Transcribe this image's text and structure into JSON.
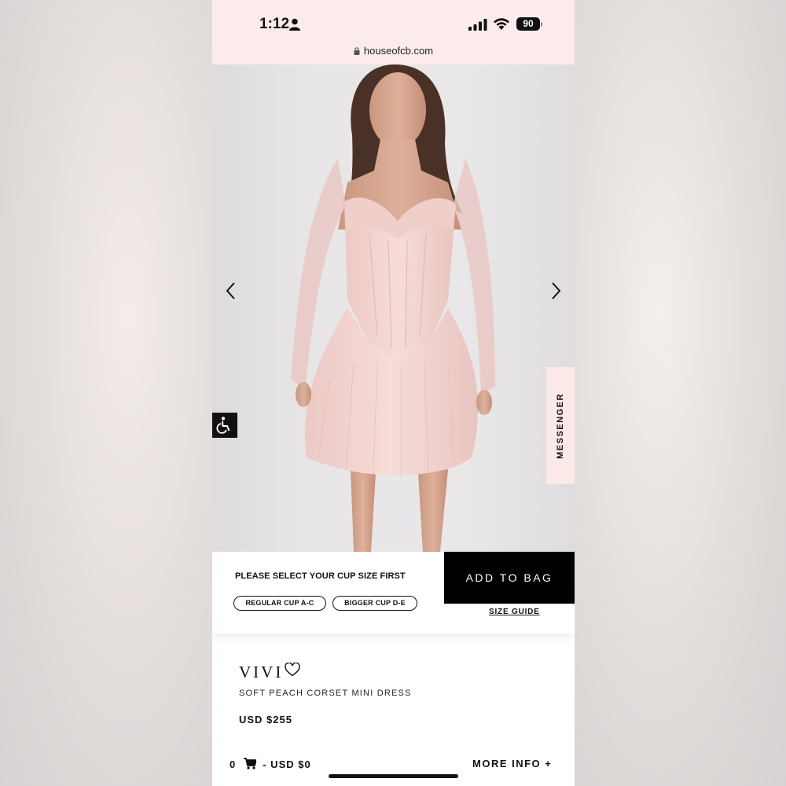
{
  "status_bar": {
    "time": "1:12",
    "battery": "90"
  },
  "browser": {
    "url": "houseofcb.com"
  },
  "gallery": {
    "messenger_label": "MESSENGER"
  },
  "cup_selector": {
    "title": "PLEASE SELECT YOUR CUP SIZE FIRST",
    "options": [
      "REGULAR CUP A-C",
      "BIGGER CUP D-E"
    ],
    "add_to_bag": "ADD TO BAG",
    "size_guide": "SIZE GUIDE"
  },
  "product": {
    "name": "VIVI",
    "subtitle": "SOFT PEACH CORSET MINI DRESS",
    "price": "USD $255"
  },
  "footer": {
    "cart_count": "0",
    "cart_total": "- USD $0",
    "more_info": "MORE INFO +"
  },
  "colors": {
    "status_bg": "#fbeceb",
    "button_bg": "#000000",
    "dress": "#f2d3d0",
    "messenger_bg": "#fbe9e8"
  }
}
